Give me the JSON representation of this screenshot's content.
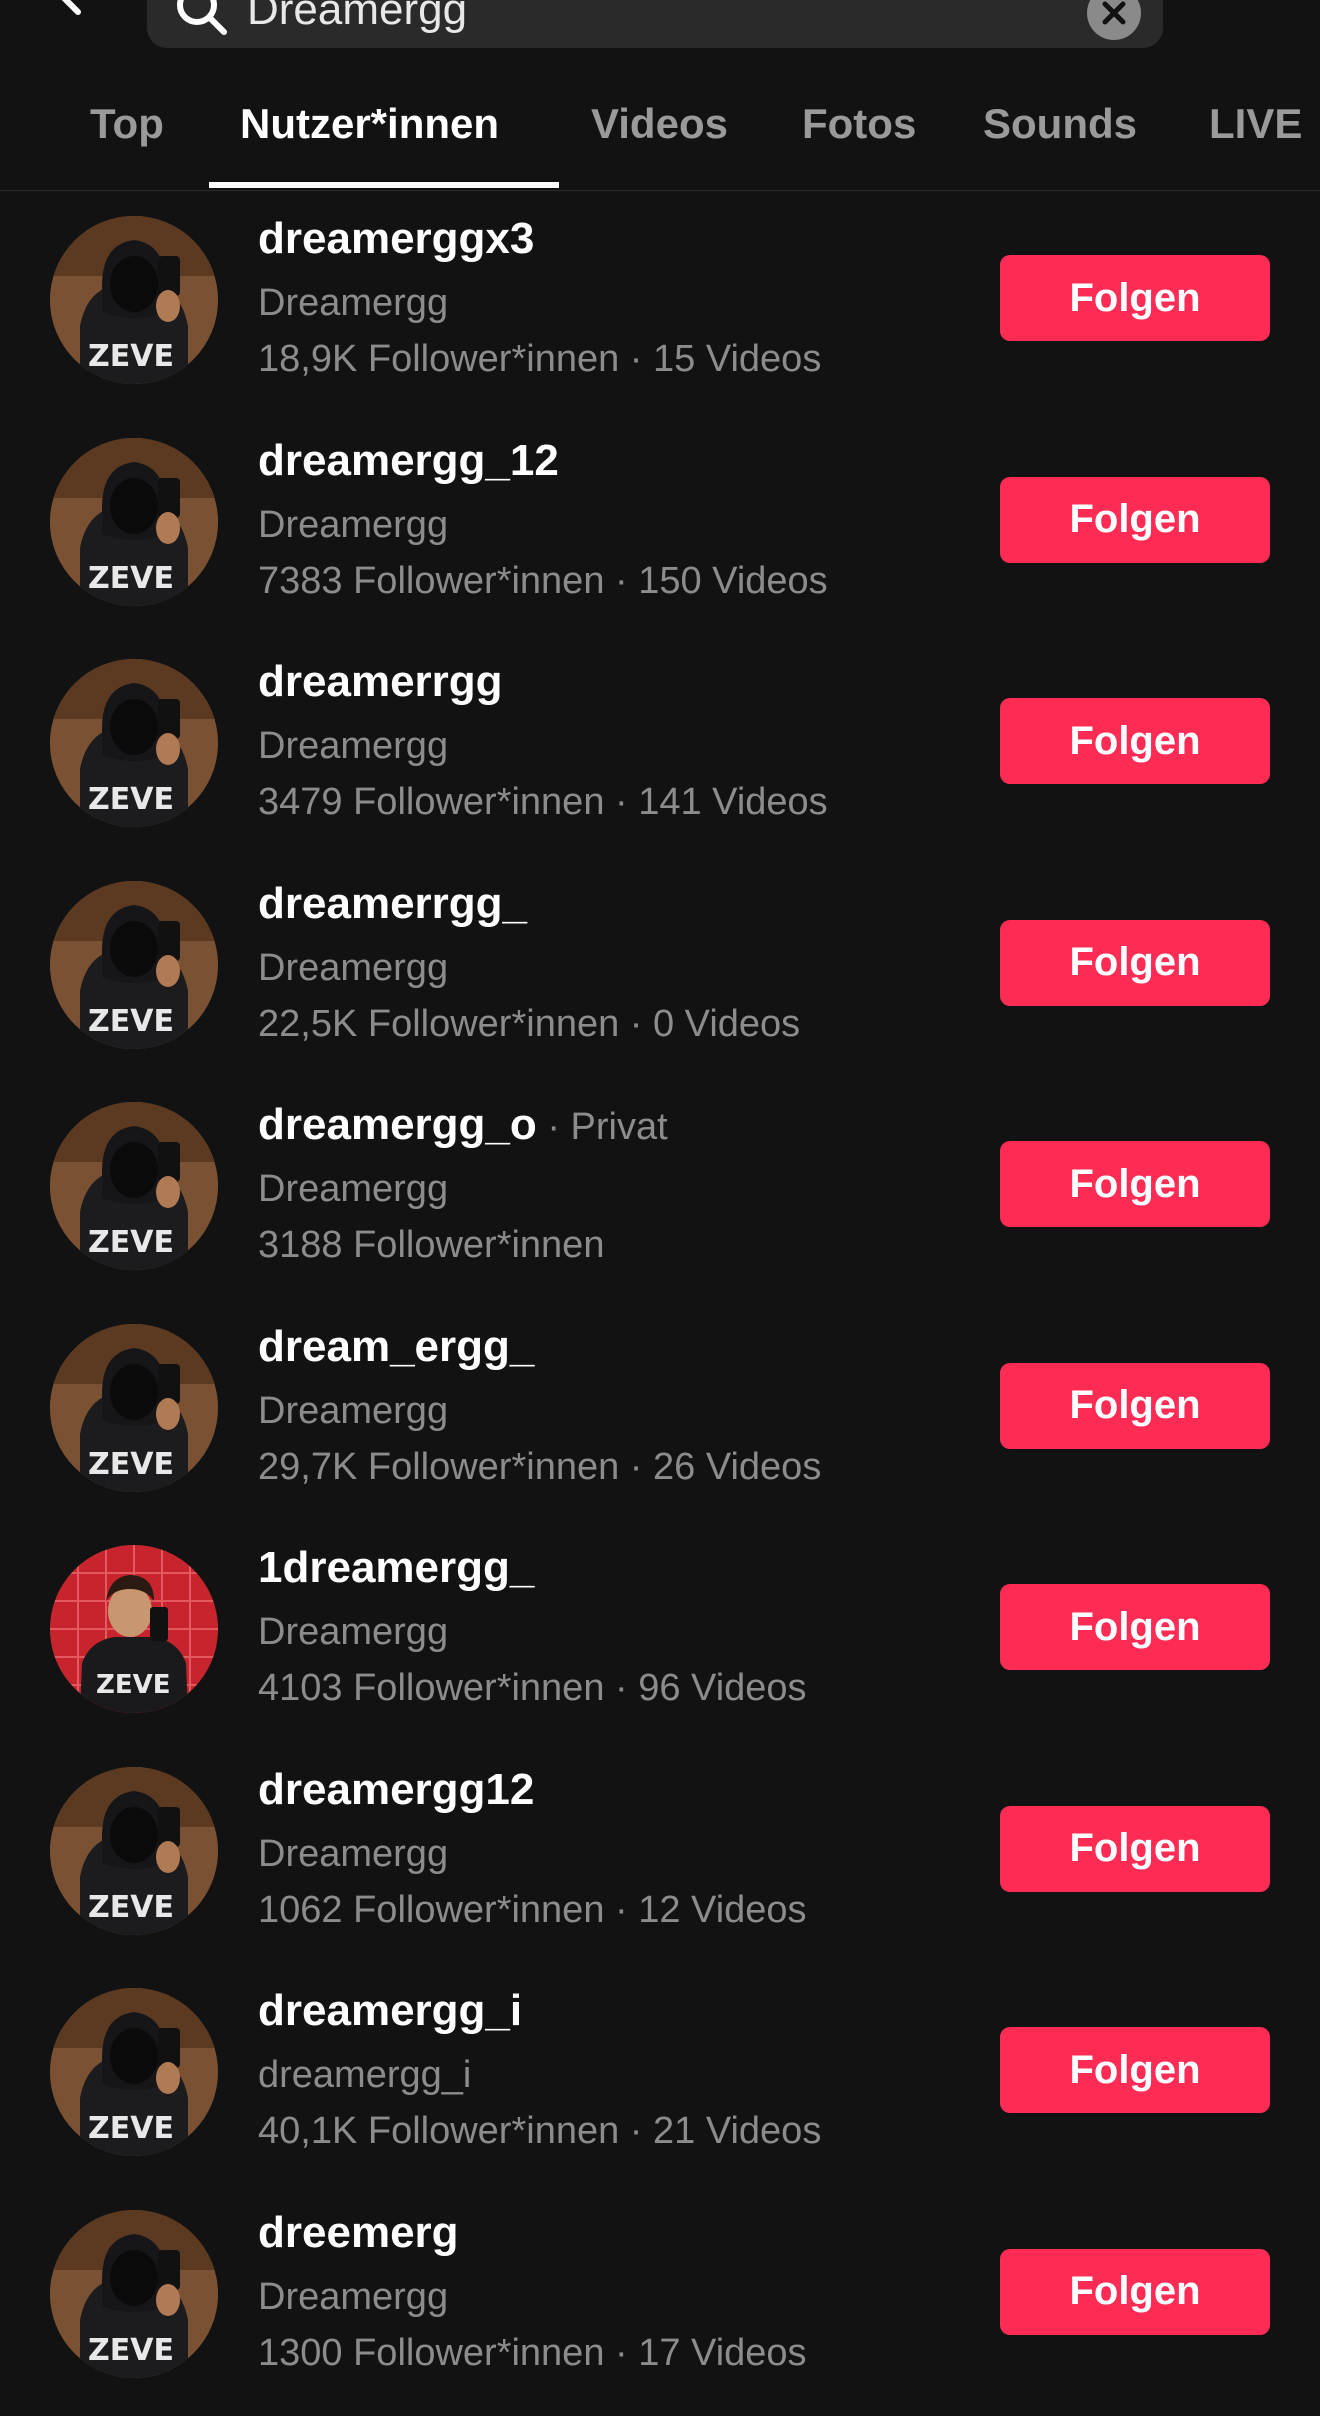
{
  "search": {
    "query": "Dreamergg"
  },
  "tabs": [
    {
      "label": "Top"
    },
    {
      "label": "Nutzer*innen"
    },
    {
      "label": "Videos"
    },
    {
      "label": "Fotos"
    },
    {
      "label": "Sounds"
    },
    {
      "label": "LIVE"
    }
  ],
  "active_tab": "Nutzer*innen",
  "colors": {
    "background": "#121212",
    "follow_button": "#fe2c55",
    "secondary_text": "#8c8c8c"
  },
  "users": [
    {
      "username": "dreamerggx3",
      "private": "",
      "display_name": "Dreamergg",
      "stats": "18,9K Follower*innen · 15 Videos",
      "follow_label": "Folgen",
      "avatar": "hooded-mirror-selfie"
    },
    {
      "username": "dreamergg_12",
      "private": "",
      "display_name": "Dreamergg",
      "stats": "7383 Follower*innen · 150 Videos",
      "follow_label": "Folgen",
      "avatar": "hooded-mirror-selfie"
    },
    {
      "username": "dreamerrgg",
      "private": "",
      "display_name": "Dreamergg",
      "stats": "3479 Follower*innen · 141 Videos",
      "follow_label": "Folgen",
      "avatar": "hooded-mirror-selfie"
    },
    {
      "username": "dreamerrgg_",
      "private": "",
      "display_name": "Dreamergg",
      "stats": "22,5K Follower*innen · 0 Videos",
      "follow_label": "Folgen",
      "avatar": "hooded-mirror-selfie"
    },
    {
      "username": "dreamergg_o",
      "private": " · Privat",
      "display_name": "Dreamergg",
      "stats": "3188 Follower*innen",
      "follow_label": "Folgen",
      "avatar": "hooded-mirror-selfie"
    },
    {
      "username": "dream_ergg_",
      "private": "",
      "display_name": "Dreamergg",
      "stats": "29,7K Follower*innen · 26 Videos",
      "follow_label": "Folgen",
      "avatar": "hooded-mirror-selfie"
    },
    {
      "username": "1dreamergg_",
      "private": "",
      "display_name": "Dreamergg",
      "stats": "4103 Follower*innen · 96 Videos",
      "follow_label": "Folgen",
      "avatar": "red-tile-selfie"
    },
    {
      "username": "dreamergg12",
      "private": "",
      "display_name": "Dreamergg",
      "stats": "1062 Follower*innen · 12 Videos",
      "follow_label": "Folgen",
      "avatar": "hooded-mirror-selfie"
    },
    {
      "username": "dreamergg_i",
      "private": "",
      "display_name": "dreamergg_i",
      "stats": "40,1K Follower*innen · 21 Videos",
      "follow_label": "Folgen",
      "avatar": "hooded-mirror-selfie"
    },
    {
      "username": "dreemerg",
      "private": "",
      "display_name": "Dreamergg",
      "stats": "1300 Follower*innen · 17 Videos",
      "follow_label": "Folgen",
      "avatar": "hooded-mirror-selfie"
    }
  ]
}
